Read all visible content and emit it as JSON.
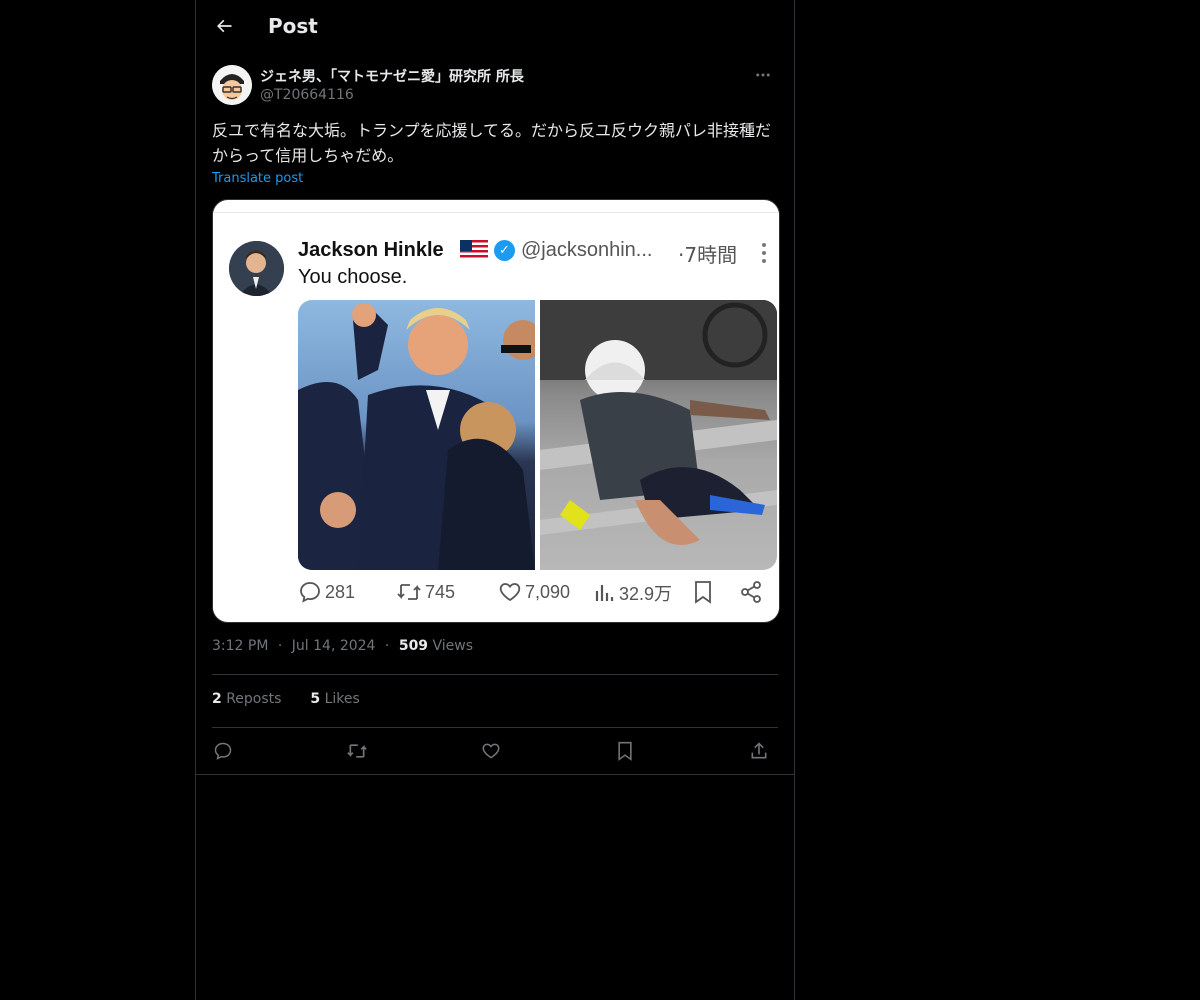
{
  "header": {
    "title": "Post"
  },
  "post": {
    "author": {
      "display_name": "ジェネ男、「マトモナゼニ愛」研究所 所長",
      "handle": "@T20664116"
    },
    "text": "反ユで有名な大垢。トランプを応援してる。だから反ユ反ウク親パレ非接種だからって信用しちゃだめ。",
    "translate_label": "Translate post",
    "meta": {
      "time": "3:12 PM",
      "separator": "·",
      "date": "Jul 14, 2024",
      "views_count": "509",
      "views_label": "Views"
    },
    "stats": {
      "reposts_count": "2",
      "reposts_label": "Reposts",
      "likes_count": "5",
      "likes_label": "Likes"
    }
  },
  "quoted_image": {
    "name": "Jackson Hinkle",
    "handle": "@jacksonhin...",
    "time": "·7時間",
    "text": "You choose.",
    "replies": "281",
    "reposts": "745",
    "likes": "7,090",
    "views": "32.9万"
  },
  "icons": {
    "back": "arrow-left-icon",
    "more": "more-horizontal-icon",
    "reply": "reply-icon",
    "repost": "repost-icon",
    "like": "heart-icon",
    "bookmark": "bookmark-icon",
    "share": "share-icon"
  },
  "colors": {
    "background": "#000000",
    "text": "#e7e9ea",
    "muted": "#71767b",
    "link": "#1d9bf0",
    "border": "#2f3336"
  }
}
